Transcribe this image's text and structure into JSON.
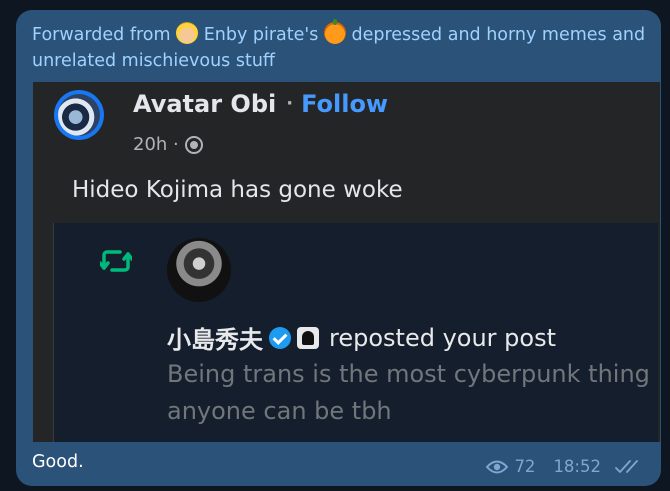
{
  "forward": {
    "prefix": "Forwarded from",
    "channel_part1": "Enby pirate's",
    "channel_part2": "depressed and horny memes and unrelated mischievous stuff"
  },
  "post": {
    "author": "Avatar Obi",
    "separator": "·",
    "follow_label": "Follow",
    "time": "20h ·",
    "text": "Hideo Kojima has gone woke"
  },
  "quote": {
    "name": "小島秀夫",
    "action": "reposted your post",
    "text": "Being trans is the most cyberpunk thing anyone can be tbh"
  },
  "message": {
    "caption": "Good.",
    "views": "72",
    "time": "18:52"
  },
  "colors": {
    "bubble": "#2b5278",
    "forward_link": "#9fd2ff",
    "follow": "#4599ff",
    "retweet_green": "#00ba7c",
    "verified": "#1d9bf0"
  }
}
